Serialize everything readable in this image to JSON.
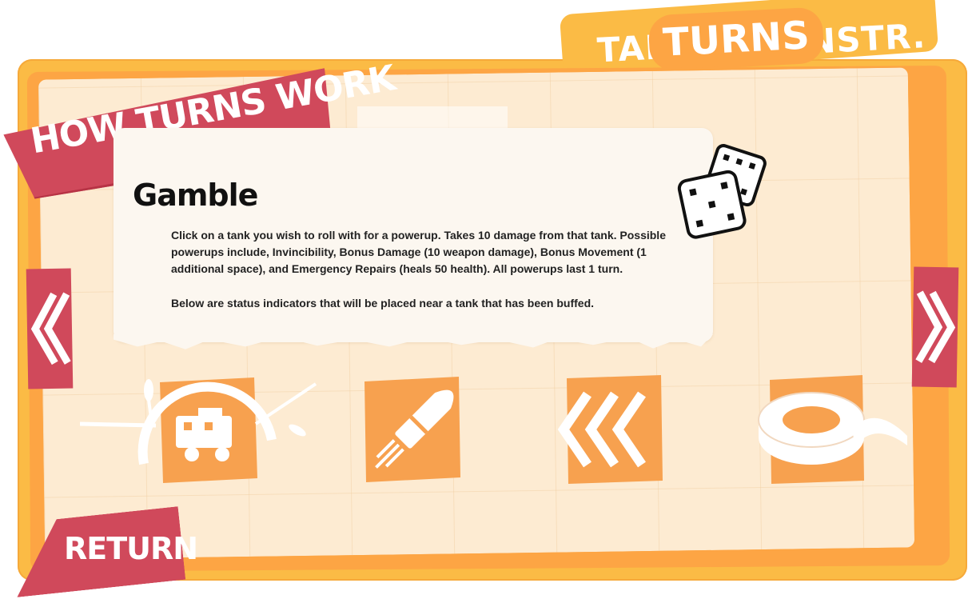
{
  "tabs": [
    {
      "label": "TANKS",
      "shown_text": "TAN",
      "active": false
    },
    {
      "label": "TURNS",
      "active": true
    },
    {
      "label": "INSTR.",
      "shown_text": "NSTR.",
      "active": false
    }
  ],
  "header": {
    "title": "HOW TURNS WORK"
  },
  "card": {
    "title": "Gamble",
    "paragraphs": [
      "Click on a tank you wish to roll with for a powerup. Takes 10 damage from that tank. Possible powerups include, Invincibility, Bonus Damage (10 weapon damage), Bonus Movement (1 additional space), and Emergency Repairs (heals 50 health). All powerups last 1 turn.",
      "Below are status indicators that will be placed near a tank that has been buffed."
    ]
  },
  "status_icons": [
    {
      "name": "invincibility",
      "icon": "shield-dome-tank-icon"
    },
    {
      "name": "bonus-damage",
      "icon": "bullet-icon"
    },
    {
      "name": "bonus-movement",
      "icon": "double-chevron-left-icon"
    },
    {
      "name": "emergency-repairs",
      "icon": "tape-roll-icon"
    }
  ],
  "navigation": {
    "prev_icon": "double-chevron-left-icon",
    "next_icon": "double-chevron-right-icon"
  },
  "footer": {
    "return_label": "RETURN"
  },
  "colors": {
    "frame": "#fbbb45",
    "frame_inner": "#fda544",
    "accent_red": "#d0495b",
    "paper": "#fdebd2",
    "tile": "#f7a14f"
  }
}
